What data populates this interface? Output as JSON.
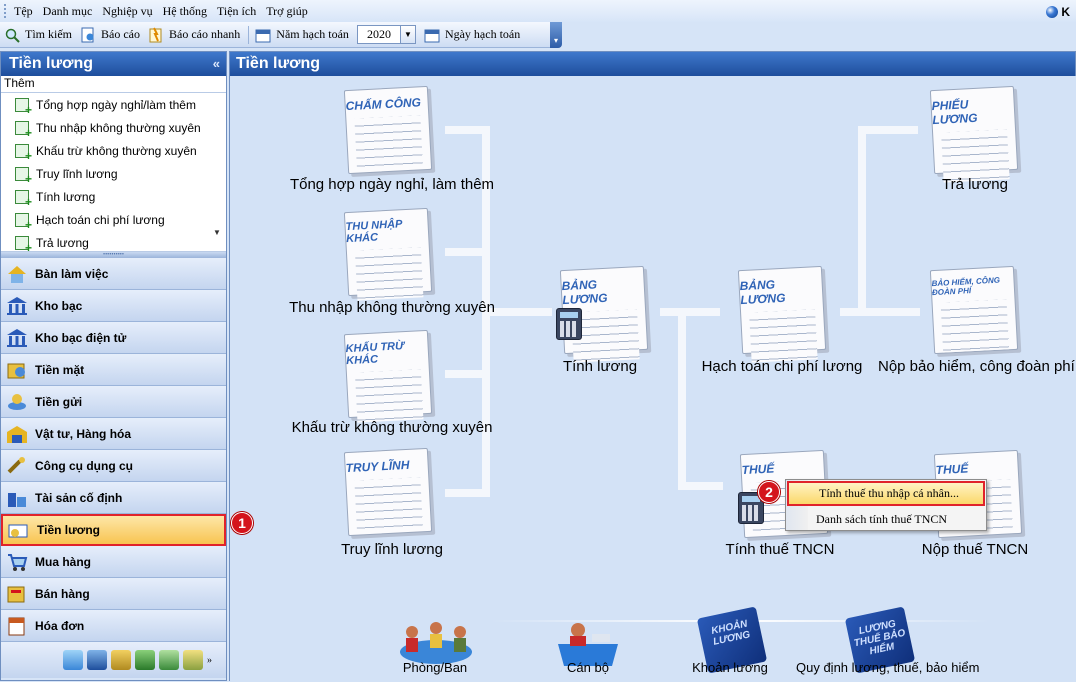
{
  "menu": [
    "Tệp",
    "Danh mục",
    "Nghiệp vụ",
    "Hệ thống",
    "Tiện ích",
    "Trợ giúp"
  ],
  "brand": "K",
  "toolbar": {
    "search": "Tìm kiếm",
    "report": "Báo cáo",
    "quick_report": "Báo cáo nhanh",
    "fiscal_year_label": "Năm hạch toán",
    "fiscal_year_value": "2020",
    "posting_date_label": "Ngày hạch toán"
  },
  "sidebar": {
    "title": "Tiền lương",
    "sub": "Thêm",
    "tasks": [
      "Tổng hợp ngày nghỉ/làm thêm",
      "Thu nhập không thường xuyên",
      "Khấu trừ không thường xuyên",
      "Truy lĩnh lương",
      "Tính lương",
      "Hạch toán chi phí lương",
      "Trả lương"
    ],
    "nav": [
      "Bàn làm việc",
      "Kho bạc",
      "Kho bạc điện tử",
      "Tiền mặt",
      "Tiền gửi",
      "Vật tư, Hàng hóa",
      "Công cụ dụng cụ",
      "Tài sản cố định",
      "Tiền lương",
      "Mua hàng",
      "Bán hàng",
      "Hóa đơn"
    ]
  },
  "main": {
    "title": "Tiền lương",
    "docs": {
      "cham_cong": "CHẤM CÔNG",
      "thu_nhap_khac": "THU NHẬP KHÁC",
      "khau_tru_khac": "KHẤU TRỪ KHÁC",
      "truy_linh": "TRUY LĨNH",
      "bang_luong": "BẢNG LƯƠNG",
      "phieu_luong": "PHIẾU LƯƠNG",
      "bao_hiem": "BẢO HIỂM, CÔNG ĐOÀN PHÍ",
      "thue": "THUẾ"
    },
    "nodes": {
      "tong_hop": "Tổng hợp ngày nghỉ, làm thêm",
      "thu_nhap": "Thu nhập không thường xuyên",
      "khau_tru": "Khấu trừ không thường xuyên",
      "truy_linh": "Truy lĩnh lương",
      "tinh_luong": "Tính lương",
      "hach_toan": "Hạch toán chi phí lương",
      "tinh_thue": "Tính thuế TNCN",
      "tra_luong": "Trả lương",
      "nop_bao_hiem": "Nộp bảo hiểm, công đoàn phí",
      "nop_thue": "Nộp thuế TNCN"
    },
    "bottom": {
      "phong_ban": "Phòng/Ban",
      "can_bo": "Cán bộ",
      "khoan_luong": "Khoản lương",
      "quy_dinh": "Quy định lương, thuế, bảo hiểm",
      "book_khoan_luong": "KHOẢN LƯƠNG",
      "book_quy_dinh": "LƯƠNG THUẾ BẢO HIỂM"
    }
  },
  "context_menu": {
    "item1": "Tính thuế thu nhập cá nhân...",
    "item2": "Danh sách tính thuế TNCN"
  },
  "badges": {
    "one": "1",
    "two": "2"
  }
}
